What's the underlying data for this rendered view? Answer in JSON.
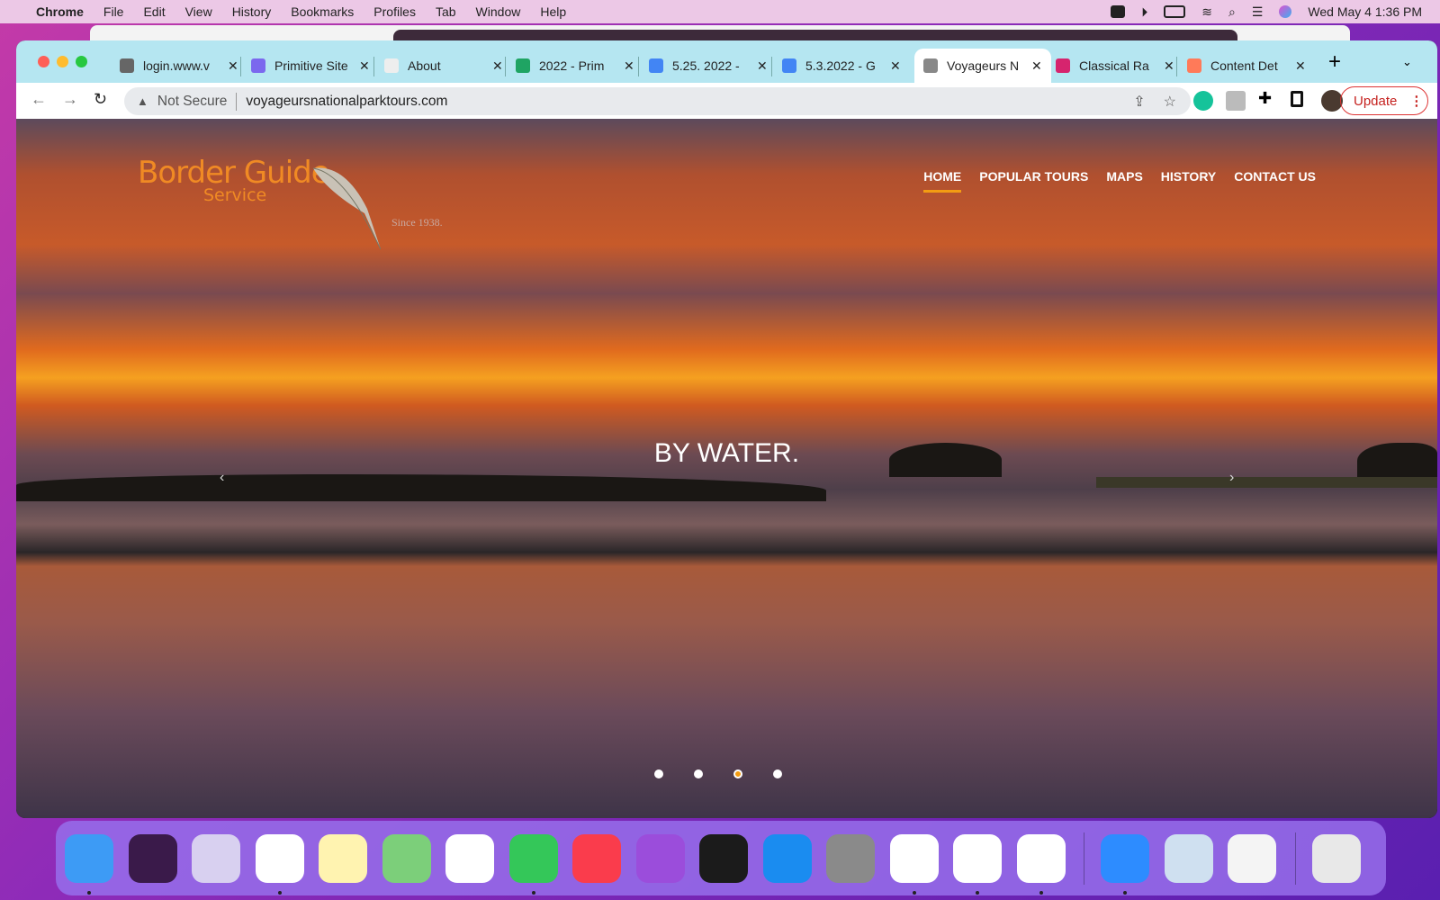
{
  "menubar": {
    "app": "Chrome",
    "items": [
      "File",
      "Edit",
      "View",
      "History",
      "Bookmarks",
      "Profiles",
      "Tab",
      "Window",
      "Help"
    ],
    "clock": "Wed May 4  1:36 PM"
  },
  "tabs": [
    {
      "title": "login.www.v",
      "icon": "globe-icon",
      "color": "#666"
    },
    {
      "title": "Primitive Site",
      "icon": "clickup-icon",
      "color": "#7b68ee"
    },
    {
      "title": "About",
      "icon": "p-logo-icon",
      "color": "#eee"
    },
    {
      "title": "2022 - Prim",
      "icon": "google-drive-icon",
      "color": "#1fa463"
    },
    {
      "title": "5.25. 2022 -",
      "icon": "google-docs-icon",
      "color": "#4285f4"
    },
    {
      "title": "5.3.2022 - G",
      "icon": "google-docs-icon",
      "color": "#4285f4"
    },
    {
      "title": "Voyageurs N",
      "icon": "feather-icon",
      "color": "#888",
      "active": true
    },
    {
      "title": "Classical Ra",
      "icon": "classical-radio-icon",
      "color": "#d6246e"
    },
    {
      "title": "Content Det",
      "icon": "hubspot-icon",
      "color": "#ff7a59"
    }
  ],
  "address": {
    "security": "Not Secure",
    "url": "voyageursnationalparktours.com"
  },
  "toolbar": {
    "update_label": "Update"
  },
  "site": {
    "logo": {
      "name": "Border Guide",
      "sub": "Service",
      "since": "Since 1938."
    },
    "nav": [
      "HOME",
      "POPULAR TOURS",
      "MAPS",
      "HISTORY",
      "CONTACT US"
    ],
    "active_nav": "HOME",
    "caption": "BY WATER.",
    "slides": 4,
    "active_slide": 3,
    "accent": "#f39c12"
  },
  "dock": [
    {
      "name": "finder",
      "color": "#3d9bf5",
      "running": true
    },
    {
      "name": "siri",
      "color": "#3a1a4a",
      "running": false
    },
    {
      "name": "launchpad",
      "color": "#d8d0f0",
      "running": false
    },
    {
      "name": "chrome",
      "color": "#ffffff",
      "running": true
    },
    {
      "name": "notes",
      "color": "#fff3b0",
      "running": false
    },
    {
      "name": "maps",
      "color": "#7ccf7a",
      "running": false
    },
    {
      "name": "photos",
      "color": "#ffffff",
      "running": false
    },
    {
      "name": "messages",
      "color": "#34c759",
      "running": true
    },
    {
      "name": "music",
      "color": "#fa3c4c",
      "running": false
    },
    {
      "name": "podcasts",
      "color": "#9b4ddb",
      "running": false
    },
    {
      "name": "apple-tv",
      "color": "#1b1b1b",
      "running": false
    },
    {
      "name": "app-store",
      "color": "#1a8cf0",
      "running": false
    },
    {
      "name": "system-preferences",
      "color": "#8a8a8a",
      "running": false
    },
    {
      "name": "slack",
      "color": "#ffffff",
      "running": true
    },
    {
      "name": "clickup",
      "color": "#ffffff",
      "running": true
    },
    {
      "name": "printer",
      "color": "#ffffff",
      "running": true
    },
    {
      "name": "zoom",
      "color": "#2d8cff",
      "running": true
    },
    {
      "name": "preview",
      "color": "#cfe0f0",
      "running": false
    },
    {
      "name": "textedit",
      "color": "#f4f4f4",
      "running": false
    },
    {
      "name": "trash",
      "color": "#e8e8e8",
      "running": false
    }
  ]
}
